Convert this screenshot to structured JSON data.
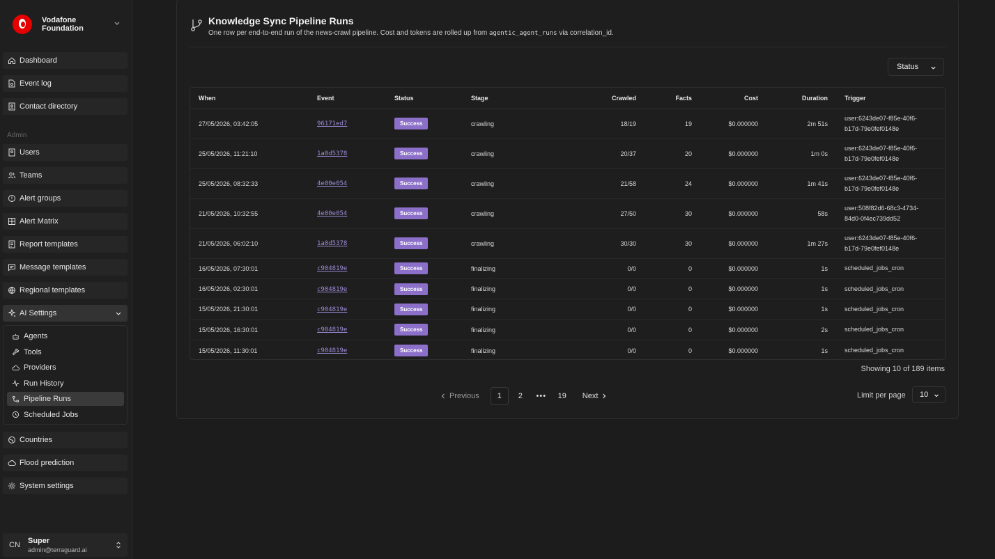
{
  "brand": {
    "name_line1": "Vodafone",
    "name_line2": "Foundation"
  },
  "nav": {
    "dashboard": "Dashboard",
    "event_log": "Event log",
    "contact_directory": "Contact directory",
    "admin_label": "Admin",
    "users": "Users",
    "teams": "Teams",
    "alert_groups": "Alert groups",
    "alert_matrix": "Alert Matrix",
    "report_templates": "Report templates",
    "message_templates": "Message templates",
    "regional_templates": "Regional templates",
    "ai_settings": "AI Settings",
    "countries": "Countries",
    "flood_prediction": "Flood prediction",
    "system_settings": "System settings"
  },
  "ai_sub": {
    "agents": "Agents",
    "tools": "Tools",
    "providers": "Providers",
    "run_history": "Run History",
    "pipeline_runs": "Pipeline Runs",
    "scheduled_jobs": "Scheduled Jobs"
  },
  "user": {
    "initials": "CN",
    "name": "Super",
    "email": "admin@terraguard.ai"
  },
  "page": {
    "title": "Knowledge Sync Pipeline Runs",
    "desc_before": "One row per end-to-end run of the news-crawl pipeline. Cost and tokens are rolled up from ",
    "desc_code": "agentic_agent_runs",
    "desc_after": " via correlation_id."
  },
  "filter": {
    "status_label": "Status"
  },
  "table": {
    "headers": {
      "when": "When",
      "event": "Event",
      "status": "Status",
      "stage": "Stage",
      "crawled": "Crawled",
      "facts": "Facts",
      "cost": "Cost",
      "duration": "Duration",
      "trigger": "Trigger"
    },
    "rows": [
      {
        "when": "27/05/2026, 03:42:05",
        "event": "96171ed7",
        "status": "Success",
        "stage": "crawling",
        "crawled": "18/19",
        "facts": "19",
        "cost": "$0.000000",
        "duration": "2m 51s",
        "trigger": "user:6243de07-f85e-40f6-b17d-79e0fef0148e"
      },
      {
        "when": "25/05/2026, 11:21:10",
        "event": "1a0d5378",
        "status": "Success",
        "stage": "crawling",
        "crawled": "20/37",
        "facts": "20",
        "cost": "$0.000000",
        "duration": "1m 0s",
        "trigger": "user:6243de07-f85e-40f6-b17d-79e0fef0148e"
      },
      {
        "when": "25/05/2026, 08:32:33",
        "event": "4e00e054",
        "status": "Success",
        "stage": "crawling",
        "crawled": "21/58",
        "facts": "24",
        "cost": "$0.000000",
        "duration": "1m 41s",
        "trigger": "user:6243de07-f85e-40f6-b17d-79e0fef0148e"
      },
      {
        "when": "21/05/2026, 10:32:55",
        "event": "4e00e054",
        "status": "Success",
        "stage": "crawling",
        "crawled": "27/50",
        "facts": "30",
        "cost": "$0.000000",
        "duration": "58s",
        "trigger": "user:508f82d6-68c3-4734-84d0-0f4ec739dd52"
      },
      {
        "when": "21/05/2026, 06:02:10",
        "event": "1a0d5378",
        "status": "Success",
        "stage": "crawling",
        "crawled": "30/30",
        "facts": "30",
        "cost": "$0.000000",
        "duration": "1m 27s",
        "trigger": "user:6243de07-f85e-40f6-b17d-79e0fef0148e"
      },
      {
        "when": "16/05/2026, 07:30:01",
        "event": "c904819e",
        "status": "Success",
        "stage": "finalizing",
        "crawled": "0/0",
        "facts": "0",
        "cost": "$0.000000",
        "duration": "1s",
        "trigger": "scheduled_jobs_cron"
      },
      {
        "when": "16/05/2026, 02:30:01",
        "event": "c904819e",
        "status": "Success",
        "stage": "finalizing",
        "crawled": "0/0",
        "facts": "0",
        "cost": "$0.000000",
        "duration": "1s",
        "trigger": "scheduled_jobs_cron"
      },
      {
        "when": "15/05/2026, 21:30:01",
        "event": "c904819e",
        "status": "Success",
        "stage": "finalizing",
        "crawled": "0/0",
        "facts": "0",
        "cost": "$0.000000",
        "duration": "1s",
        "trigger": "scheduled_jobs_cron"
      },
      {
        "when": "15/05/2026, 16:30:01",
        "event": "c904819e",
        "status": "Success",
        "stage": "finalizing",
        "crawled": "0/0",
        "facts": "0",
        "cost": "$0.000000",
        "duration": "2s",
        "trigger": "scheduled_jobs_cron"
      },
      {
        "when": "15/05/2026, 11:30:01",
        "event": "c904819e",
        "status": "Success",
        "stage": "finalizing",
        "crawled": "0/0",
        "facts": "0",
        "cost": "$0.000000",
        "duration": "1s",
        "trigger": "scheduled_jobs_cron"
      }
    ]
  },
  "summary": {
    "showing": "Showing 10 of 189 items"
  },
  "pagination": {
    "previous": "Previous",
    "next": "Next",
    "pages": [
      "1",
      "2",
      "19"
    ],
    "ellipsis": "•••",
    "current": "1"
  },
  "limit": {
    "label": "Limit per page",
    "value": "10"
  },
  "colors": {
    "badge_success": "#8b6fc9",
    "link": "#9c8ad6",
    "brand_red": "#e60000"
  }
}
